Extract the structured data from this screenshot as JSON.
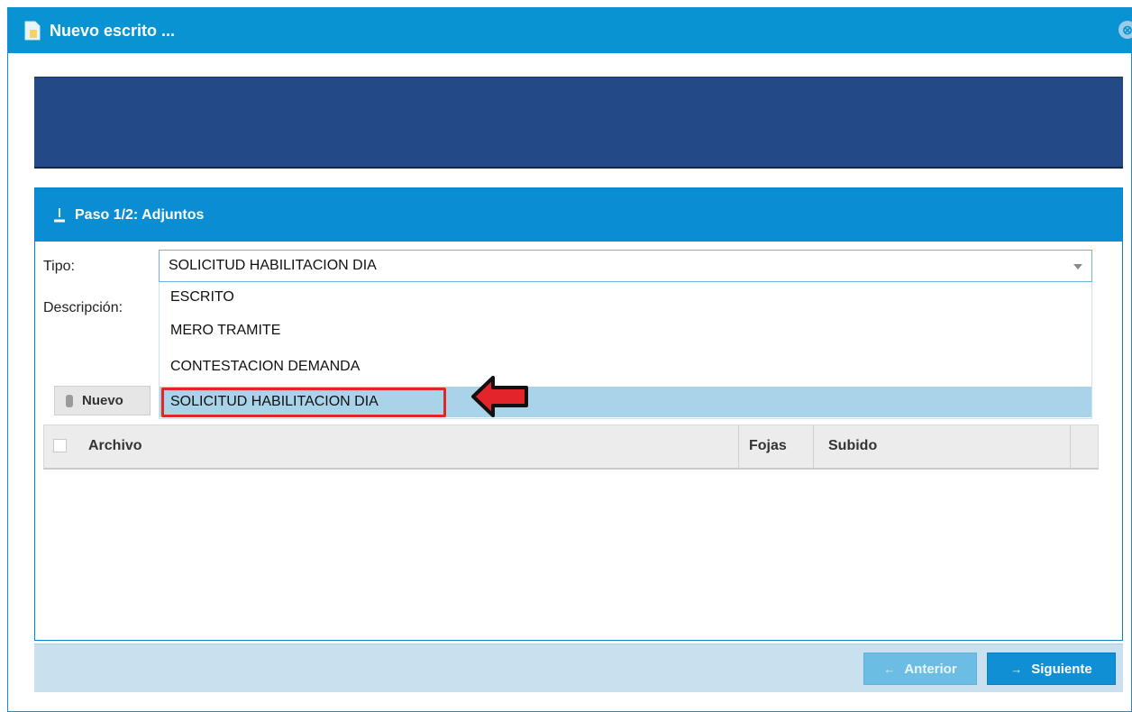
{
  "window": {
    "title": "Nuevo escrito ..."
  },
  "panel": {
    "header": "Paso 1/2: Adjuntos"
  },
  "form": {
    "tipo_label": "Tipo:",
    "descripcion_label": "Descripción:",
    "tipo_value": "SOLICITUD HABILITACION DIA",
    "options": [
      "ESCRITO",
      "MERO TRAMITE",
      "CONTESTACION DEMANDA",
      "SOLICITUD HABILITACION DIA"
    ]
  },
  "toolbar": {
    "nuevo_label": "Nuevo"
  },
  "table": {
    "columns": [
      "Archivo",
      "Fojas",
      "Subido"
    ]
  },
  "footer": {
    "prev_label": "Anterior",
    "next_label": "Siguiente"
  },
  "colors": {
    "titlebar": "#0a93d3",
    "banner": "#234a87",
    "highlight_border": "#e3242b",
    "selected_option": "#a8d3e8"
  },
  "icons": [
    "document-icon",
    "close-icon",
    "upload-icon",
    "chevron-down-icon",
    "red-arrow-icon",
    "attachment-icon",
    "arrow-left-icon",
    "arrow-right-icon"
  ]
}
